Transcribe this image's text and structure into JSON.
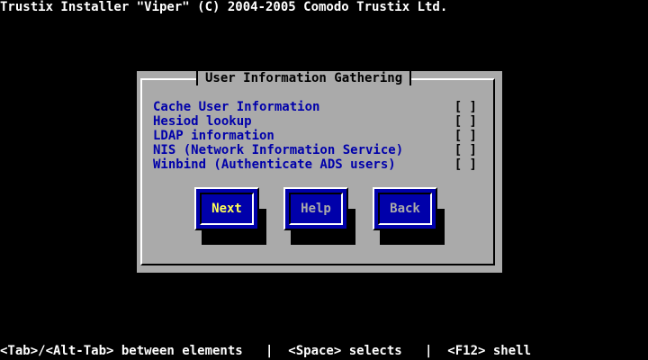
{
  "header": {
    "title": "Trustix Installer \"Viper\" (C) 2004-2005 Comodo Trustix Ltd."
  },
  "dialog": {
    "title": "User Information Gathering",
    "options": [
      {
        "label": "Cache User Information",
        "checkbox": "[ ]"
      },
      {
        "label": "Hesiod lookup",
        "checkbox": "[ ]"
      },
      {
        "label": "LDAP information",
        "checkbox": "[ ]"
      },
      {
        "label": "NIS (Network Information Service)",
        "checkbox": "[ ]"
      },
      {
        "label": "Winbind (Authenticate ADS users)",
        "checkbox": "[ ]"
      }
    ],
    "buttons": {
      "next": "Next",
      "help": "Help",
      "back": "Back"
    }
  },
  "footer": {
    "help_text": "<Tab>/<Alt-Tab> between elements   |  <Space> selects   |  <F12> shell"
  },
  "colors": {
    "background": "#000000",
    "dialog": "#aaaaaa",
    "option_text": "#0000aa",
    "button": "#0000aa",
    "focused_button_text": "#ffff55"
  }
}
